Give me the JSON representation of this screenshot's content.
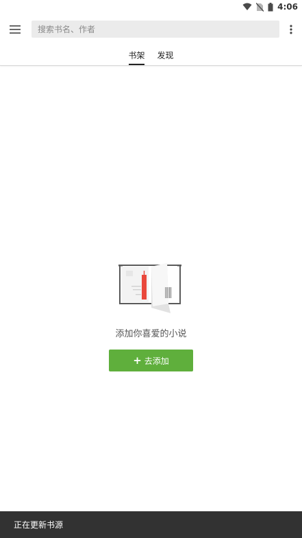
{
  "status_bar": {
    "time": "4:06",
    "icons": [
      "wifi-icon",
      "no-sim-icon",
      "battery-icon"
    ]
  },
  "toolbar": {
    "menu_icon": "hamburger-menu-icon",
    "search_placeholder": "搜索书名、作者",
    "more_icon": "more-vert-icon"
  },
  "tabs": [
    {
      "label": "书架",
      "active": true
    },
    {
      "label": "发现",
      "active": false
    }
  ],
  "empty_state": {
    "illustration": "empty-bookshelf-illustration",
    "message": "添加你喜爱的小说",
    "button_label": "去添加",
    "button_icon": "+"
  },
  "snackbar": {
    "message": "正在更新书源"
  },
  "colors": {
    "accent_green": "#5faf3c",
    "snackbar_bg": "#323232",
    "search_bg": "#ebebeb",
    "bookmark_red": "#e9483c"
  }
}
